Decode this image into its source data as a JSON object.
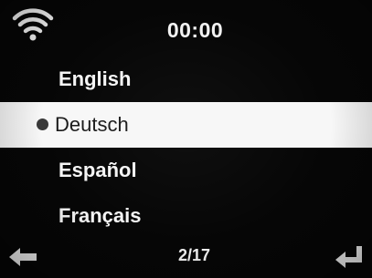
{
  "status": {
    "clock": "00:00",
    "wifi_icon": "wifi-icon"
  },
  "menu": {
    "items": [
      {
        "label": "English",
        "selected": false
      },
      {
        "label": "Deutsch",
        "selected": true
      },
      {
        "label": "Español",
        "selected": false
      },
      {
        "label": "Français",
        "selected": false
      }
    ]
  },
  "footer": {
    "page": "2/17",
    "back_icon": "back-arrow-icon",
    "enter_icon": "enter-icon"
  },
  "colors": {
    "background": "#060606",
    "text": "#f5f5f5",
    "selection": "#f7f7f7",
    "selection_text": "#1a1a1a"
  }
}
